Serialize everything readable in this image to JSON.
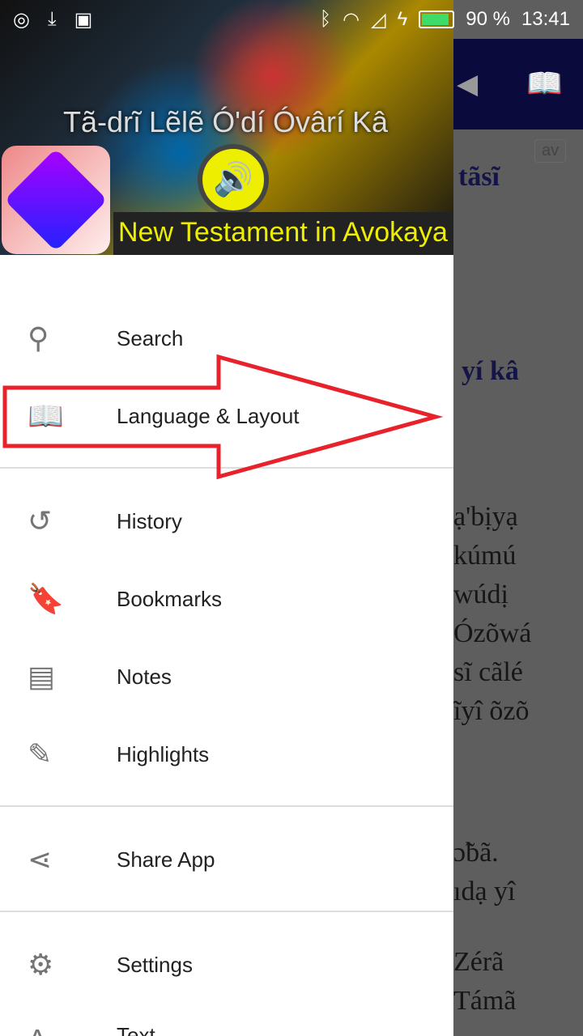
{
  "status_bar": {
    "battery": "90 %",
    "battery_level": 0.9,
    "time": "13:41"
  },
  "banner": {
    "title": "Tã-drĩ Lẽlẽ Ó'dí Óvârí Kâ",
    "subtitle": "New Testament in Avokaya"
  },
  "menu": [
    {
      "label": "Search",
      "icon": "search-icon"
    },
    {
      "label": "Language & Layout",
      "icon": "book-icon"
    },
    {
      "label": "History",
      "icon": "history-icon"
    },
    {
      "label": "Bookmarks",
      "icon": "bookmark-icon"
    },
    {
      "label": "Notes",
      "icon": "note-icon"
    },
    {
      "label": "Highlights",
      "icon": "pencil-icon"
    },
    {
      "label": "Share App",
      "icon": "share-icon"
    },
    {
      "label": "Settings",
      "icon": "gear-icon"
    },
    {
      "label": "Text",
      "icon": "text-icon"
    }
  ],
  "background": {
    "lang_badge": "av",
    "lines": [
      "tãsĩ",
      "yí kâ",
      "ạ'bịyạ",
      "kúmú",
      "wúdị",
      "Ózõwá",
      "sĩ cãlé",
      "ĩyî õzõ",
      "ɔ̃bã.",
      "ıdạ yî",
      "Zérã",
      "Támã"
    ]
  },
  "colors": {
    "accent": "#0a0a3c",
    "annotation_arrow": "#e8222a"
  }
}
